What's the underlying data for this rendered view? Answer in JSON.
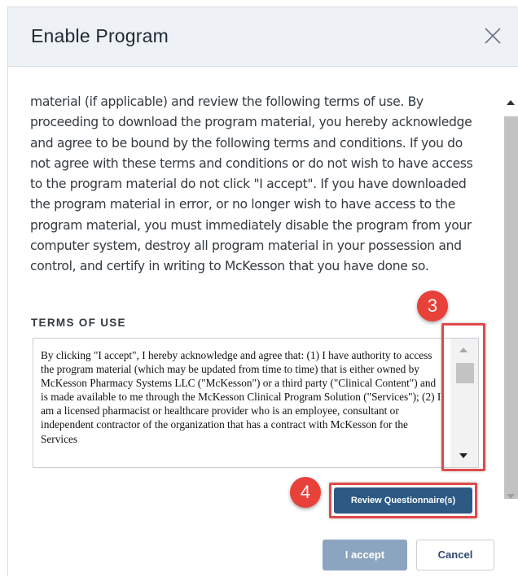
{
  "dialog": {
    "title": "Enable Program",
    "close_icon": "close-icon"
  },
  "intro": {
    "text": "material (if applicable) and review the following terms of use. By proceeding to download the program material, you hereby acknowledge and agree to be bound by the following terms and conditions. If you do not agree with these terms and conditions or do not wish to have access to the program material do not click \"I accept\". If you have downloaded the program material in error, or no longer wish to have access to the program material, you must immediately disable the program from your computer system, destroy all program material in your possession and control, and certify in writing to McKesson that you have done so."
  },
  "terms": {
    "heading": "TERMS OF USE",
    "text": "By clicking \"I accept\", I hereby acknowledge and agree that: (1) I have authority to access the program material (which may be updated from time to time) that is either owned by McKesson Pharmacy Systems LLC (\"McKesson\") or a third party (\"Clinical Content\") and is made available to me through the McKesson Clinical Program Solution (\"Services\"); (2) I am a licensed pharmacist or healthcare provider who is an employee, consultant or independent contractor of the organization that has a contract with McKesson for the Services"
  },
  "annotations": {
    "badge_scroll": "3",
    "badge_review": "4",
    "highlight_color": "#e04a4a"
  },
  "buttons": {
    "review": "Review Questionnaire(s)",
    "accept": "I accept",
    "cancel": "Cancel"
  },
  "colors": {
    "header_bg": "#eef1f5",
    "primary": "#2d5985",
    "accept_disabled": "#8ba5c0"
  }
}
